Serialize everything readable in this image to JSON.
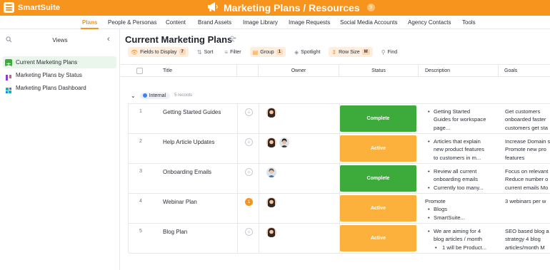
{
  "app": {
    "brand": "SmartSuite",
    "title": "Marketing Plans / Resources",
    "title_badge": "9",
    "accent": "#f7941d"
  },
  "nav_tabs": [
    {
      "label": "Plans",
      "active": true
    },
    {
      "label": "People & Personas"
    },
    {
      "label": "Content"
    },
    {
      "label": "Brand Assets"
    },
    {
      "label": "Image Library"
    },
    {
      "label": "Image Requests"
    },
    {
      "label": "Social Media Accounts"
    },
    {
      "label": "Agency Contacts"
    },
    {
      "label": "Tools"
    }
  ],
  "sidebar": {
    "title": "Views",
    "views": [
      {
        "label": "Current Marketing Plans",
        "icon": "grid-view-icon",
        "selected": true
      },
      {
        "label": "Marketing Plans by Status",
        "icon": "kanban-view-icon"
      },
      {
        "label": "Marketing Plans Dashboard",
        "icon": "dashboard-view-icon"
      }
    ]
  },
  "main": {
    "title": "Current Marketing Plans",
    "toolbar": {
      "fields": "Fields to Display",
      "fields_count": "7",
      "sort": "Sort",
      "filter": "Filter",
      "group": "Group",
      "group_count": "1",
      "spotlight": "Spotlight",
      "row_size": "Row Size",
      "row_size_value": "M",
      "find": "Find"
    },
    "columns": [
      "Title",
      "Owner",
      "Status",
      "Description",
      "Goals"
    ],
    "group": {
      "label": "Internal",
      "count": "5 records"
    },
    "rows": [
      {
        "num": "1",
        "title": "Getting Started Guides",
        "comments": "",
        "status": "Complete",
        "desc_bullets": [
          "Getting Started",
          "Guides for workspace",
          "page..."
        ],
        "goals": [
          "Get customers",
          "onboarded faster",
          "customers get sta"
        ]
      },
      {
        "num": "2",
        "title": "Help Article Updates",
        "comments": "",
        "status": "Active",
        "desc_bullets": [
          "Articles that explain",
          "new product features",
          "to customers in m..."
        ],
        "goals": [
          "Increase Domain s",
          "Promote new pro",
          "features"
        ]
      },
      {
        "num": "3",
        "title": "Onboarding Emails",
        "comments": "",
        "status": "Complete",
        "desc_bullets": [
          "Review all current",
          "onboarding emails",
          "Currently too many..."
        ],
        "goals": [
          "Focus on relevant",
          "Reduce number o",
          "current emails Mo"
        ]
      },
      {
        "num": "4",
        "title": "Webinar Plan",
        "comments": "1",
        "status": "Active",
        "desc_lead": "Promote",
        "desc_bullets": [
          "Blogs",
          "SmartSuite..."
        ],
        "goals": [
          "3 webinars per w"
        ]
      },
      {
        "num": "5",
        "title": "Blog Plan",
        "comments": "",
        "status": "Active",
        "desc_bullets": [
          "We are aiming for 4",
          "blog articles / month"
        ],
        "desc_sub": [
          "1 will be Product..."
        ],
        "goals": [
          "SEO based blog a",
          "strategy 4 blog",
          "articles/month M"
        ]
      }
    ]
  },
  "colors": {
    "complete": "#3cab3c",
    "active": "#fbb13c",
    "topbar": "#f7941d"
  }
}
